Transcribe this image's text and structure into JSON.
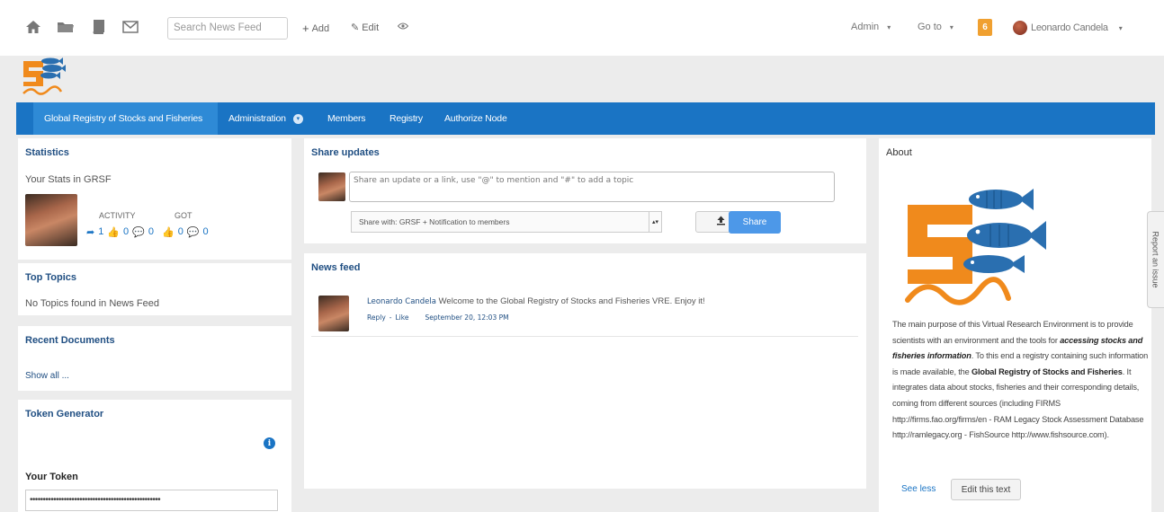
{
  "topbar": {
    "search_placeholder": "Search News Feed",
    "add_label": "Add",
    "edit_label": "Edit",
    "admin_label": "Admin",
    "goto_label": "Go to",
    "notifications_count": "6",
    "user_name": "Leonardo Candela"
  },
  "nav": {
    "items": [
      {
        "label": "Global Registry of Stocks and Fisheries"
      },
      {
        "label": "Administration"
      },
      {
        "label": "Members"
      },
      {
        "label": "Registry"
      },
      {
        "label": "Authorize Node"
      }
    ]
  },
  "statistics": {
    "title": "Statistics",
    "subtitle": "Your Stats in GRSF",
    "activity_label": "ACTIVITY",
    "got_label": "GOT",
    "activity_shares": "1",
    "activity_likes": "0",
    "activity_comments": "0",
    "got_likes": "0",
    "got_comments": "0"
  },
  "top_topics": {
    "title": "Top Topics",
    "empty_text": "No Topics found in News Feed"
  },
  "recent_documents": {
    "title": "Recent Documents",
    "show_all": "Show all ..."
  },
  "token_generator": {
    "title": "Token Generator",
    "your_token_label": "Your Token",
    "token_value": "••••••••••••••••••••••••••••••••••••••••••••••••••"
  },
  "share_updates": {
    "title": "Share updates",
    "placeholder": "Share an update or a link, use \"@\" to mention and \"#\" to add a topic",
    "share_with": "Share with: GRSF + Notification to members",
    "share_button": "Share"
  },
  "news_feed": {
    "title": "News feed",
    "posts": [
      {
        "author": "Leonardo Candela",
        "text": "Welcome to the Global Registry of Stocks and Fisheries VRE. Enjoy it!",
        "reply": "Reply",
        "separator": "-",
        "like": "Like",
        "date": "September 20, 12:03 PM"
      }
    ]
  },
  "about": {
    "title": "About",
    "p1": "The main purpose of this Virtual Research Environment is to provide scientists with an environment and the tools for",
    "p1_bold_italic": "accessing stocks and fisheries information",
    "p2": ". To this end a registry containing such information is made available, the",
    "p2_bold": "Global Registry of Stocks and Fisheries",
    "p3": ". It integrates data about stocks, fisheries and their corresponding details, coming from different sources (including FIRMS http://firms.fao.org/firms/en - RAM Legacy Stock Assessment Database http://ramlegacy.org - FishSource http://www.fishsource.com).",
    "see_less": "See less",
    "edit_button": "Edit this text"
  },
  "report_issue_label": "Report an issue",
  "colors": {
    "nav_bg": "#1a74c4",
    "nav_active": "#2e8ad6",
    "title_blue": "#1f4e82",
    "logo_orange": "#f08a1c",
    "logo_blue": "#2a6fb0"
  }
}
